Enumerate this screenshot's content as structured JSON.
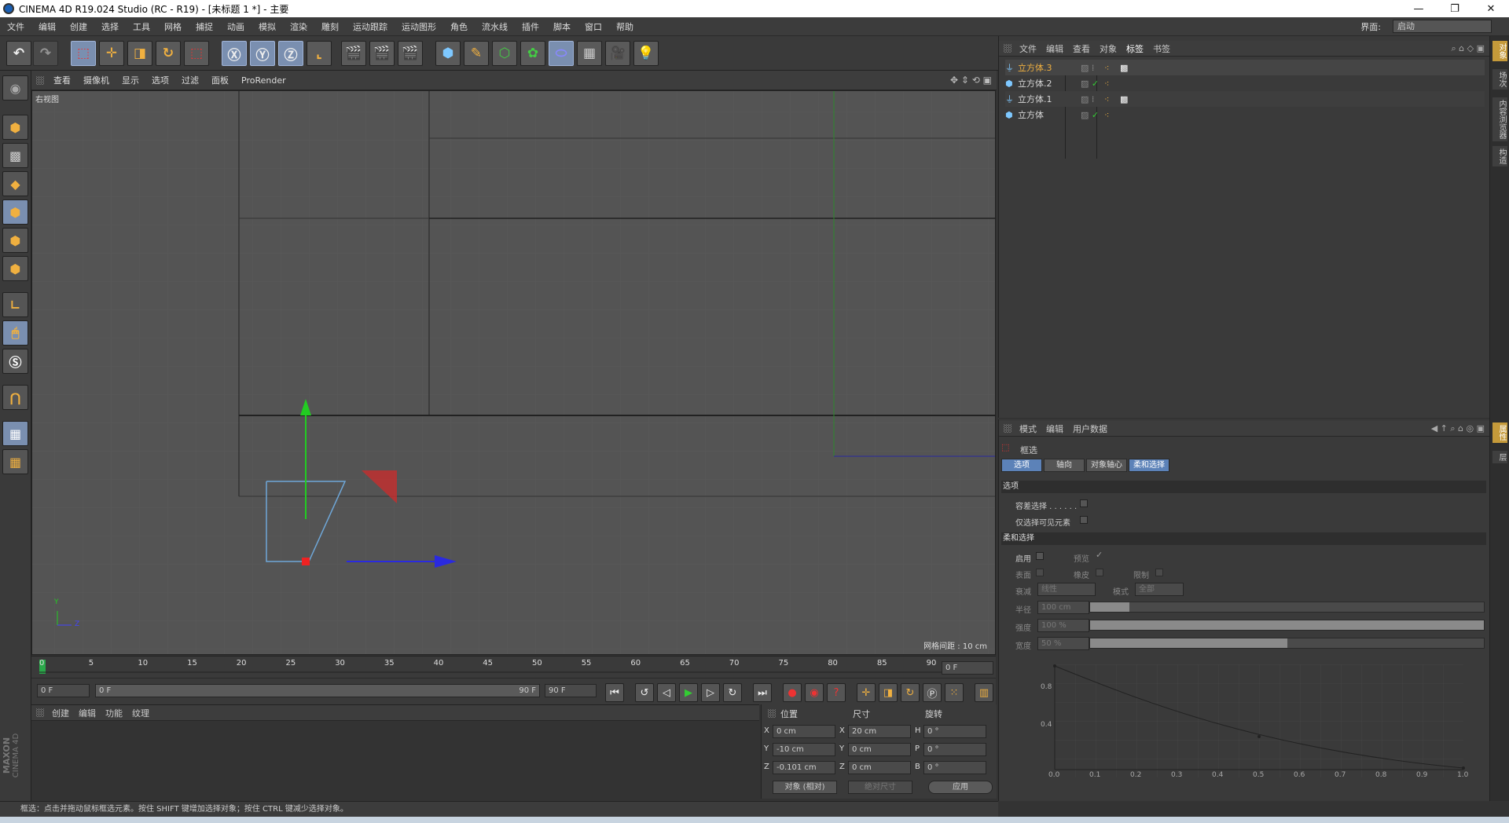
{
  "window": {
    "title": "CINEMA 4D R19.024 Studio (RC - R19) - [未标题 1 *] - 主要",
    "min": "—",
    "max": "❐",
    "close": "✕"
  },
  "menu": [
    "文件",
    "编辑",
    "创建",
    "选择",
    "工具",
    "网格",
    "捕捉",
    "动画",
    "模拟",
    "渲染",
    "雕刻",
    "运动跟踪",
    "运动图形",
    "角色",
    "流水线",
    "插件",
    "脚本",
    "窗口",
    "帮助"
  ],
  "layout": {
    "label": "界面:",
    "value": "启动"
  },
  "viewport": {
    "menu": [
      "查看",
      "摄像机",
      "显示",
      "选项",
      "过滤",
      "面板",
      "ProRender"
    ],
    "view_name": "右视图",
    "grid_spacing": "网格间距 : 10 cm",
    "axis_y": "Y",
    "axis_z": "Z"
  },
  "timeline": {
    "ticks": [
      "0",
      "5",
      "10",
      "15",
      "20",
      "25",
      "30",
      "35",
      "40",
      "45",
      "50",
      "55",
      "60",
      "65",
      "70",
      "75",
      "80",
      "85",
      "90"
    ],
    "current_frame": "0 F",
    "start": "0 F",
    "range_start": "0 F",
    "range_end": "90 F",
    "end": "90 F"
  },
  "material_panel": {
    "menu": [
      "创建",
      "编辑",
      "功能",
      "纹理"
    ],
    "brand1": "MAXON",
    "brand2": "CINEMA 4D"
  },
  "coords": {
    "headers": [
      "位置",
      "尺寸",
      "旋转"
    ],
    "rows": [
      {
        "a": "X",
        "pos": "0 cm",
        "b": "X",
        "size": "20 cm",
        "c": "H",
        "rot": "0 °"
      },
      {
        "a": "Y",
        "pos": "-10 cm",
        "b": "Y",
        "size": "0 cm",
        "c": "P",
        "rot": "0 °"
      },
      {
        "a": "Z",
        "pos": "-0.101 cm",
        "b": "Z",
        "size": "0 cm",
        "c": "B",
        "rot": "0 °"
      }
    ],
    "mode": "对象 (相对)",
    "size_mode": "绝对尺寸",
    "apply": "应用"
  },
  "status": "框选：点击并拖动鼠标框选元素。按住 SHIFT 键增加选择对象；按住 CTRL 键减少选择对象。",
  "objects": {
    "menu": [
      "文件",
      "编辑",
      "查看",
      "对象",
      "标签",
      "书签"
    ],
    "items": [
      {
        "name": "立方体.3",
        "selected": true
      },
      {
        "name": "立方体.2",
        "selected": false
      },
      {
        "name": "立方体.1",
        "selected": false
      },
      {
        "name": "立方体",
        "selected": false
      }
    ]
  },
  "attributes": {
    "menu": [
      "模式",
      "编辑",
      "用户数据"
    ],
    "tool_name": "框选",
    "tabs": [
      "选项",
      "轴向",
      "对象轴心",
      "柔和选择"
    ],
    "sec_options": "选项",
    "tolerant": "容差选择 . . . . . .",
    "visible_only": "仅选择可见元素",
    "sec_soft": "柔和选择",
    "enable": "启用",
    "preview": "预览",
    "surface": "表面",
    "rubber": "橡皮",
    "restrict": "限制",
    "falloff": "衰减",
    "falloff_val": "线性",
    "mode": "模式",
    "mode_val": "全部",
    "radius": "半径",
    "radius_val": "100 cm",
    "radius_frac": 0.1,
    "strength": "强度",
    "strength_val": "100 %",
    "strength_frac": 1.0,
    "width": "宽度",
    "width_val": "50 %",
    "width_frac": 0.5,
    "graph_y": [
      "0.8",
      "0.4"
    ],
    "graph_x": [
      "0.0",
      "0.1",
      "0.2",
      "0.3",
      "0.4",
      "0.5",
      "0.6",
      "0.7",
      "0.8",
      "0.9",
      "1.0"
    ]
  },
  "side_tabs": [
    "对象",
    "场次",
    "内容浏览器",
    "构造",
    "属性",
    "层"
  ]
}
